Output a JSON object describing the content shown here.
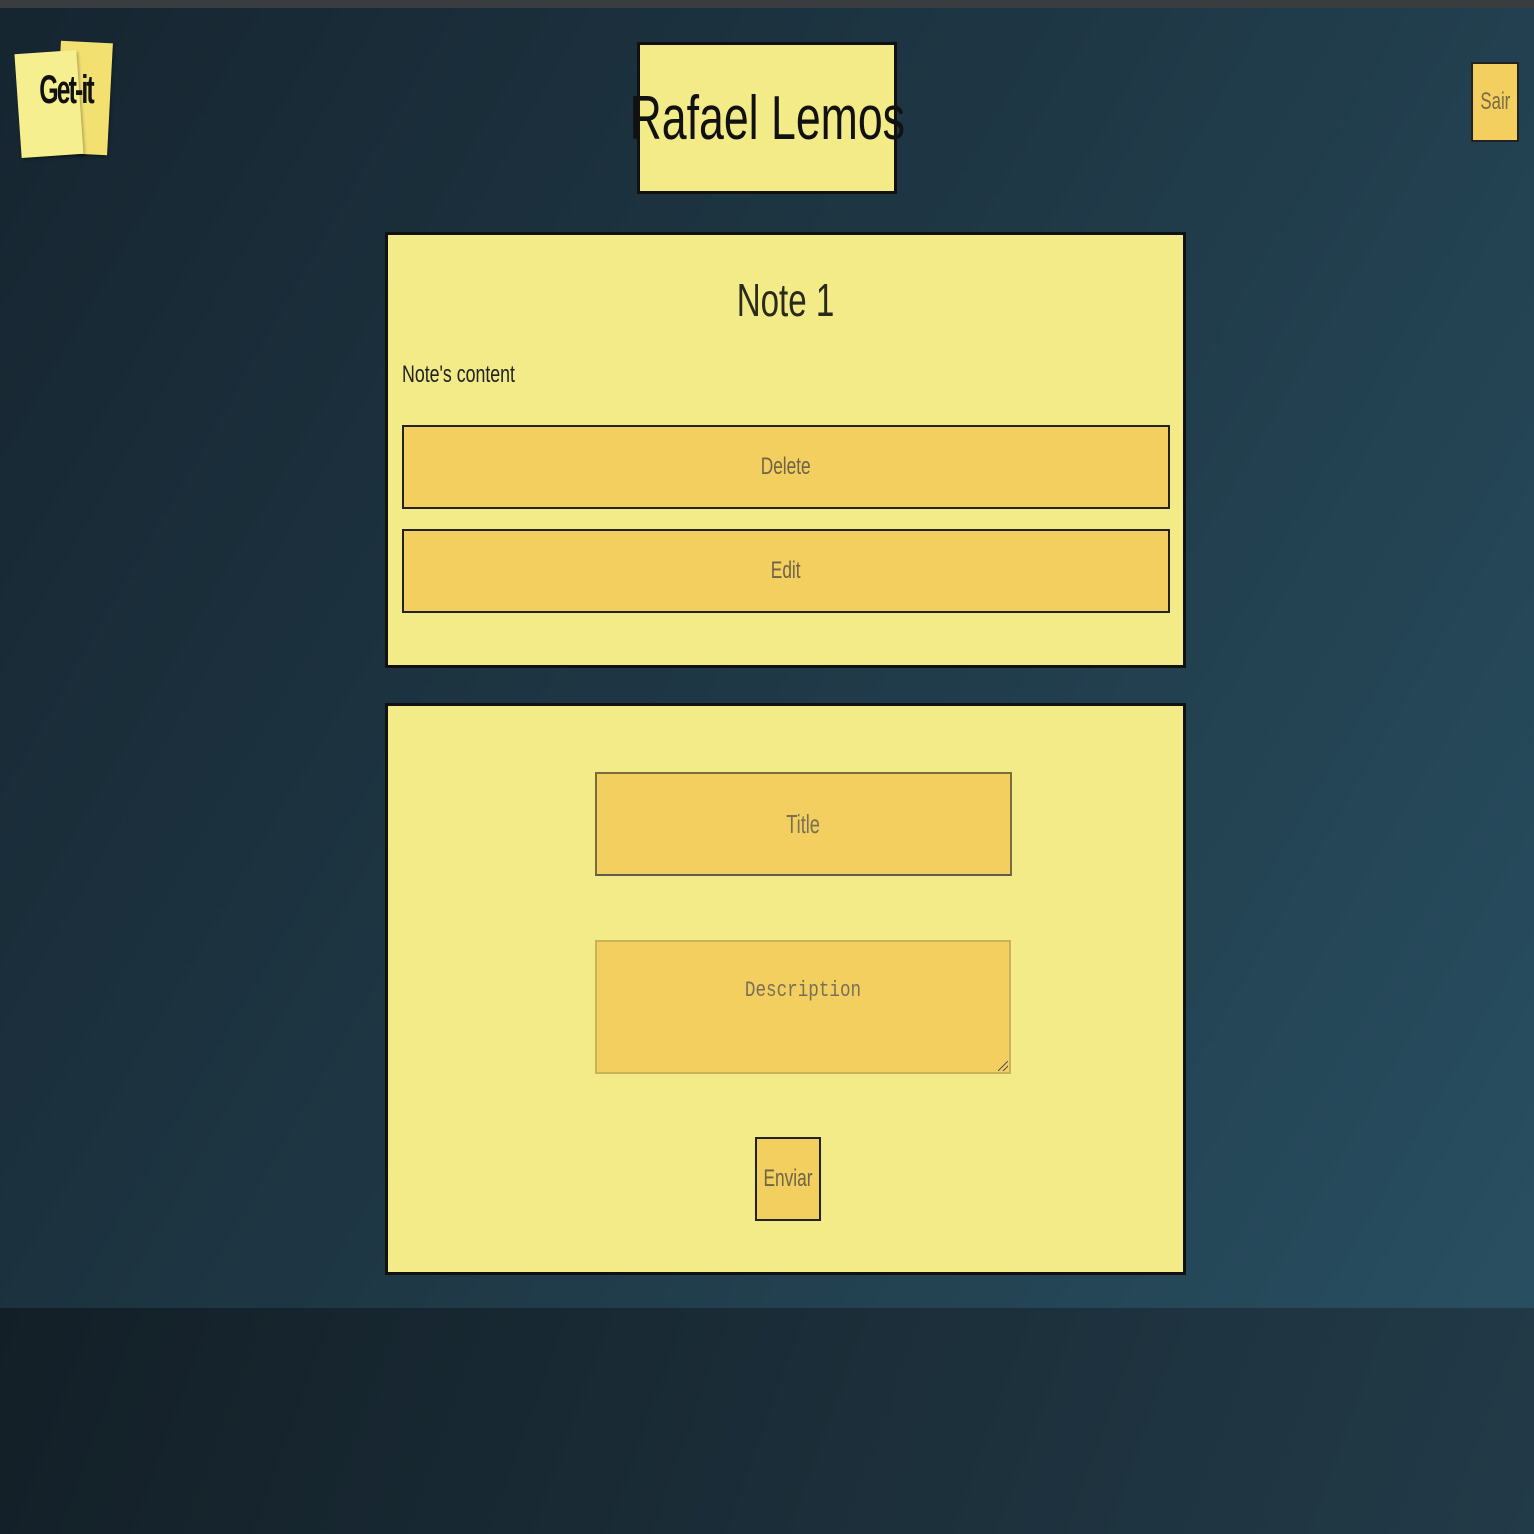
{
  "header": {
    "logo_text": "Get-it",
    "user_name": "Rafael Lemos",
    "logout_label": "Sair"
  },
  "note": {
    "title": "Note 1",
    "content": "Note's content",
    "delete_label": "Delete",
    "edit_label": "Edit"
  },
  "form": {
    "title_placeholder": "Title",
    "description_placeholder": "Description",
    "submit_label": "Enviar"
  },
  "colors": {
    "card_background": "#f2eb88",
    "button_background": "#f2cf5e",
    "page_background": "#1f3846"
  }
}
